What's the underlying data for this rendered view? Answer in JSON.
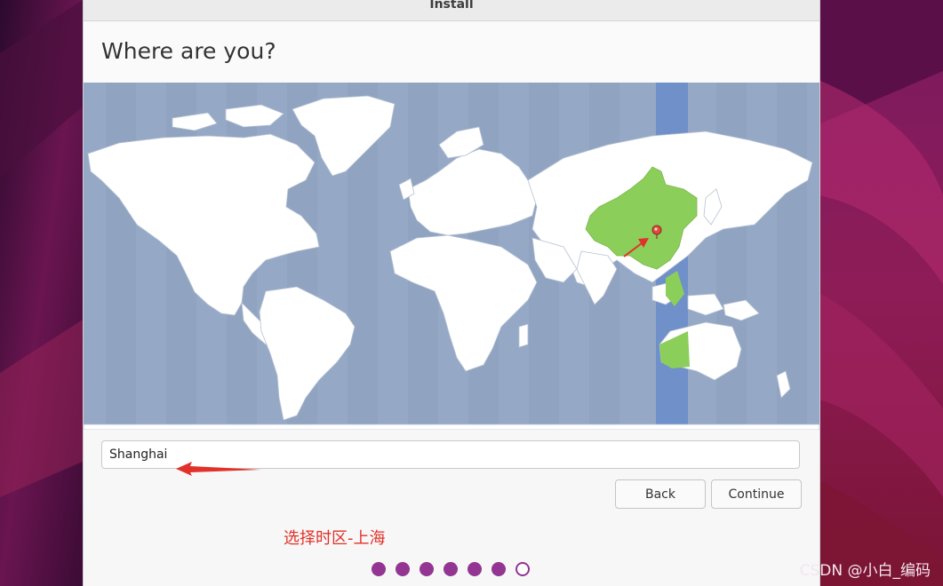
{
  "window": {
    "title": "Install"
  },
  "page": {
    "heading": "Where are you?"
  },
  "timezone": {
    "value": "Shanghai"
  },
  "buttons": {
    "back": "Back",
    "continue": "Continue"
  },
  "annotation": {
    "text": "选择时区-上海",
    "color": "#e0322a"
  },
  "progress": {
    "total_steps": 7,
    "completed_steps": 6,
    "dot_color": "#923593"
  },
  "watermark": "CSDN @小白_编码",
  "colors": {
    "map_ocean": "#95a9c6",
    "selected_zone": "#6f90c8",
    "selected_country": "#8cce5a",
    "desktop_accent": "#8a1a5c"
  },
  "icons": {
    "location_pin": "location-pin-icon"
  }
}
